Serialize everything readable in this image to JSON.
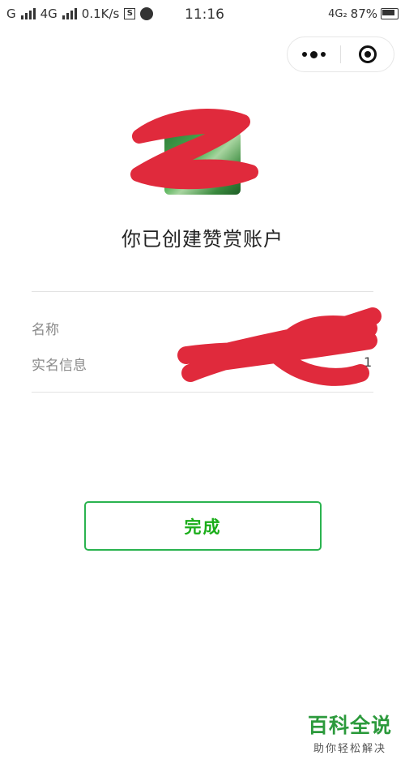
{
  "status_bar": {
    "carrier1": "G",
    "carrier2": "4G",
    "speed": "0.1K/s",
    "s_icon_label": "S",
    "time": "11:16",
    "network_badge": "4G₂",
    "battery": "87%"
  },
  "capsule": {
    "more_icon": "more-dots-icon",
    "close_icon": "target-close-icon"
  },
  "page": {
    "title": "你已创建赞赏账户"
  },
  "info": {
    "name_label": "名称",
    "realname_label": "实名信息",
    "realname_value_tail": "1"
  },
  "actions": {
    "done_label": "完成"
  },
  "colors": {
    "accent": "#1aad19",
    "scribble": "#e02a3c"
  },
  "watermark": {
    "title": "百科全说",
    "subtitle": "助你轻松解决"
  }
}
